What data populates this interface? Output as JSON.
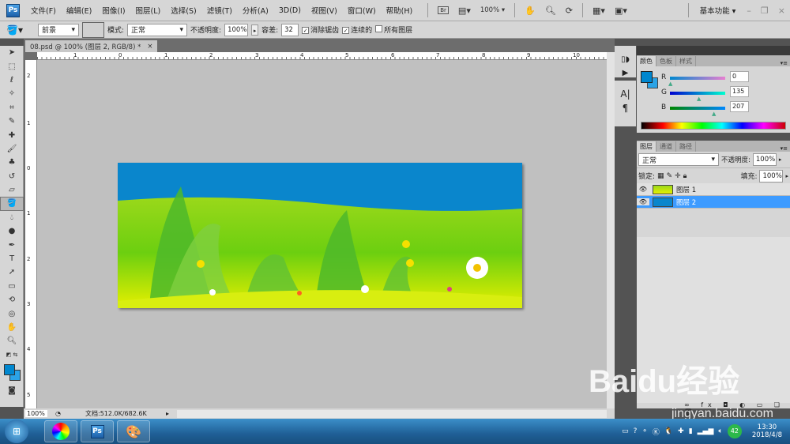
{
  "app": {
    "logo": "Ps"
  },
  "menu": [
    "文件(F)",
    "编辑(E)",
    "图像(I)",
    "图层(L)",
    "选择(S)",
    "滤镜(T)",
    "分析(A)",
    "3D(D)",
    "视图(V)",
    "窗口(W)",
    "帮助(H)"
  ],
  "appbar": {
    "bridge": "Br",
    "zoom": "100%",
    "workspace": "基本功能"
  },
  "options": {
    "fill_source": "前景",
    "mode_label": "模式:",
    "mode": "正常",
    "opacity_label": "不透明度:",
    "opacity": "100%",
    "tolerance_label": "容差:",
    "tolerance": "32",
    "antialias": "消除锯齿",
    "contiguous": "连续的",
    "all_layers": "所有图层"
  },
  "document": {
    "tab_title": "08.psd @ 100% (图层 2, RGB/8) *",
    "close": "×"
  },
  "rulers": {
    "h": [
      "1",
      "0",
      "1",
      "2",
      "3",
      "4",
      "5",
      "6",
      "7",
      "8",
      "9",
      "10"
    ],
    "v": [
      "2",
      "1",
      "0",
      "1",
      "2",
      "3",
      "4",
      "5"
    ]
  },
  "status": {
    "zoom": "100%",
    "doc_info": "文档:512.0K/682.6K"
  },
  "color_panel": {
    "tabs": [
      "颜色",
      "色板",
      "样式"
    ],
    "r_label": "R",
    "g_label": "G",
    "b_label": "B",
    "r": "0",
    "g": "135",
    "b": "207",
    "fg_color": "#0087cf",
    "bg_color": "#2ba3e6"
  },
  "layers_panel": {
    "tabs": [
      "图层",
      "通道",
      "路径"
    ],
    "blend": "正常",
    "opacity_label": "不透明度:",
    "opacity": "100%",
    "lock_label": "锁定:",
    "fill_label": "填充:",
    "fill": "100%",
    "layers": [
      {
        "name": "图层 1",
        "selected": false
      },
      {
        "name": "图层 2",
        "selected": true
      }
    ]
  },
  "taskbar": {
    "time": "13:30",
    "date": "2018/4/8",
    "badge": "42",
    "ps": "Ps"
  },
  "watermark": {
    "brand": "Baidu经验",
    "url": "jingyan.baidu.com"
  }
}
